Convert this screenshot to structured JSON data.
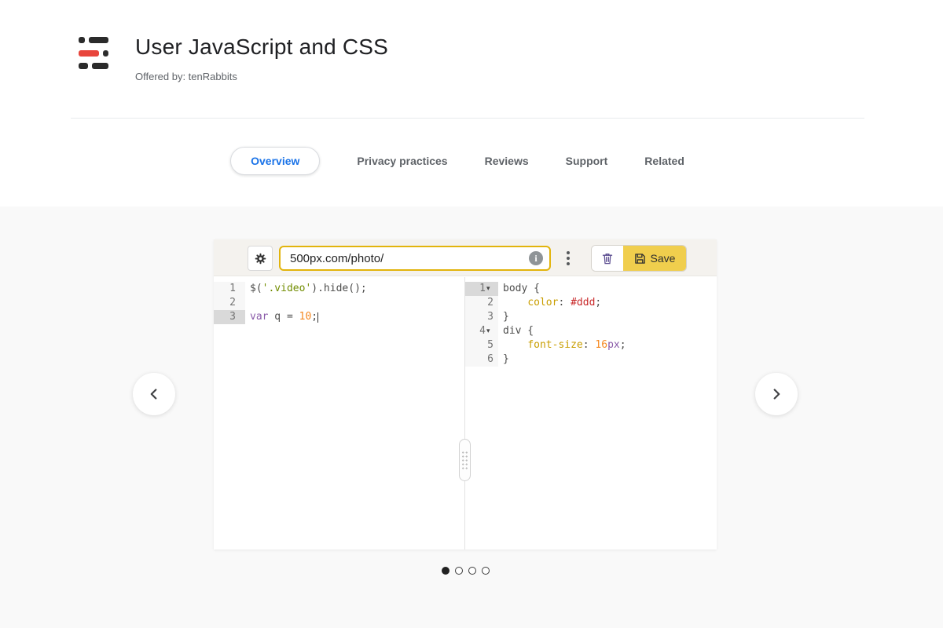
{
  "header": {
    "title": "User JavaScript and CSS",
    "offered_by": "Offered by: tenRabbits"
  },
  "tabs": [
    {
      "label": "Overview",
      "selected": true
    },
    {
      "label": "Privacy practices",
      "selected": false
    },
    {
      "label": "Reviews",
      "selected": false
    },
    {
      "label": "Support",
      "selected": false
    },
    {
      "label": "Related",
      "selected": false
    }
  ],
  "screenshot": {
    "toolbar": {
      "url_value": "500px.com/photo/",
      "save_label": "Save",
      "icons": {
        "settings": "gear-icon",
        "info": "info-icon",
        "menu": "kebab-icon",
        "delete": "trash-icon",
        "save": "floppy-icon"
      }
    },
    "fold_icon": "▾",
    "js_editor": {
      "lines": [
        {
          "num": "1",
          "active": false,
          "fold": false,
          "tokens": [
            {
              "t": "$(",
              "c": "plain"
            },
            {
              "t": "'.video'",
              "c": "string"
            },
            {
              "t": ").hide();",
              "c": "plain"
            }
          ]
        },
        {
          "num": "2",
          "active": false,
          "fold": false,
          "tokens": []
        },
        {
          "num": "3",
          "active": true,
          "fold": false,
          "tokens": [
            {
              "t": "var",
              "c": "keyword"
            },
            {
              "t": " q = ",
              "c": "plain"
            },
            {
              "t": "10",
              "c": "number"
            },
            {
              "t": ";",
              "c": "plain"
            },
            {
              "t": "",
              "c": "cursor"
            }
          ]
        }
      ]
    },
    "css_editor": {
      "lines": [
        {
          "num": "1",
          "active": true,
          "fold": true,
          "tokens": [
            {
              "t": "body {",
              "c": "plain"
            }
          ]
        },
        {
          "num": "2",
          "active": false,
          "fold": false,
          "tokens": [
            {
              "t": "    ",
              "c": "plain"
            },
            {
              "t": "color",
              "c": "property"
            },
            {
              "t": ": ",
              "c": "plain"
            },
            {
              "t": "#ddd",
              "c": "hex"
            },
            {
              "t": ";",
              "c": "plain"
            }
          ]
        },
        {
          "num": "3",
          "active": false,
          "fold": false,
          "tokens": [
            {
              "t": "}",
              "c": "plain"
            }
          ]
        },
        {
          "num": "4",
          "active": false,
          "fold": true,
          "tokens": [
            {
              "t": "div {",
              "c": "plain"
            }
          ]
        },
        {
          "num": "5",
          "active": false,
          "fold": false,
          "tokens": [
            {
              "t": "    ",
              "c": "plain"
            },
            {
              "t": "font-size",
              "c": "property"
            },
            {
              "t": ": ",
              "c": "plain"
            },
            {
              "t": "16",
              "c": "number"
            },
            {
              "t": "px",
              "c": "unit"
            },
            {
              "t": ";",
              "c": "plain"
            }
          ]
        },
        {
          "num": "6",
          "active": false,
          "fold": false,
          "tokens": [
            {
              "t": "}",
              "c": "plain"
            }
          ]
        }
      ]
    }
  },
  "carousel": {
    "dots": [
      {
        "active": true
      },
      {
        "active": false
      },
      {
        "active": false
      },
      {
        "active": false
      }
    ]
  },
  "colors": {
    "brand_red": "#e8453c",
    "tab_blue": "#1a73e8",
    "save_yellow": "#f0ce4d",
    "url_border_gold": "#e2b40c",
    "band_gray": "#f9f9f9",
    "code_string": "#718c00",
    "code_keyword": "#8959a8",
    "code_number": "#f5871f",
    "code_property": "#c99e00",
    "code_hex": "#c82829"
  }
}
